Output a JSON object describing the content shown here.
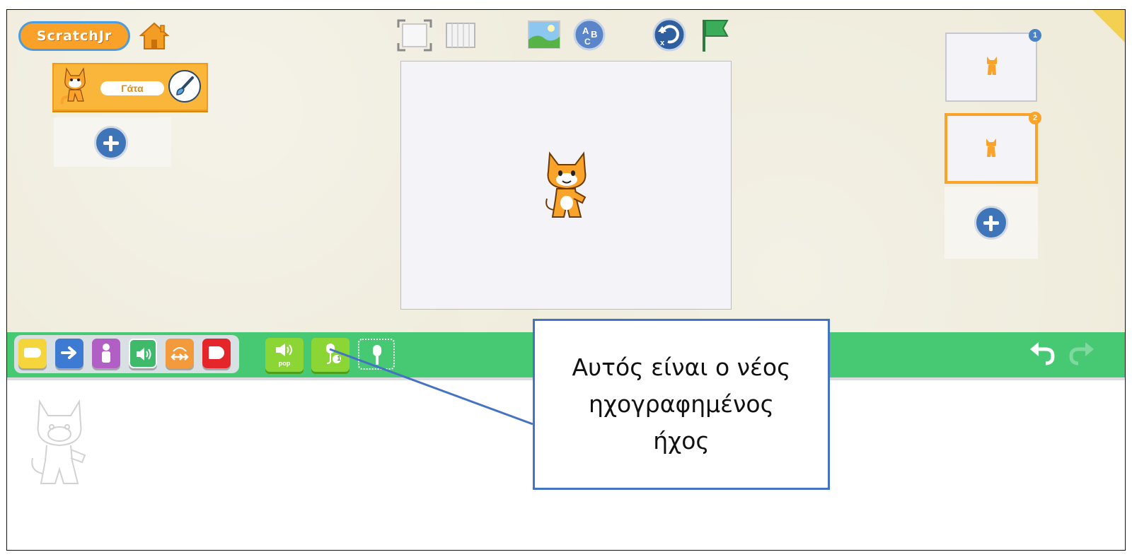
{
  "app": {
    "logo_text": "ScratchJr"
  },
  "sprite_list": {
    "selected_sprite_name": "Γάτα"
  },
  "pages": [
    {
      "number": "1",
      "selected": false
    },
    {
      "number": "2",
      "selected": true
    }
  ],
  "palette": {
    "categories": [
      {
        "name": "triggering",
        "color": "#f4d63c"
      },
      {
        "name": "motion",
        "color": "#3d7bd3"
      },
      {
        "name": "looks",
        "color": "#b15fc4"
      },
      {
        "name": "sound",
        "color": "#3fb96a"
      },
      {
        "name": "control",
        "color": "#f39a3c"
      },
      {
        "name": "end",
        "color": "#e4262a"
      }
    ],
    "sound_blocks": [
      {
        "icon": "speaker-icon",
        "label": "pop"
      },
      {
        "icon": "recorded-sound-icon",
        "label": "1"
      }
    ]
  },
  "annotation": {
    "callout_text": "Αυτός είναι ο νέος ηχογραφημένος ήχος"
  },
  "colors": {
    "toolbar_green": "#47c974",
    "selected_orange": "#f9a32a",
    "callout_border": "#4472c4"
  }
}
